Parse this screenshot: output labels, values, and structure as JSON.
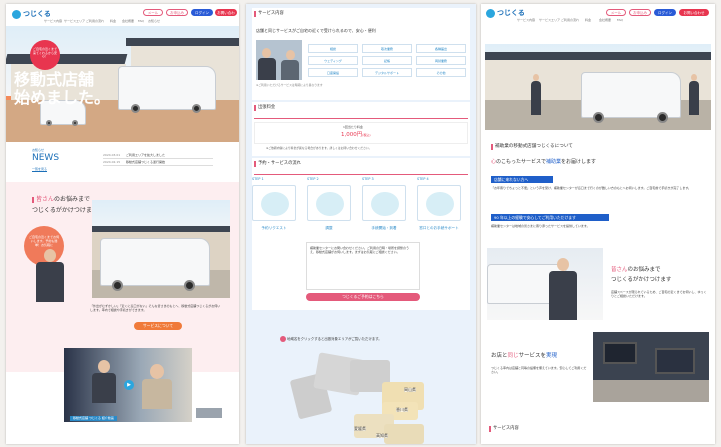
{
  "brand": {
    "logo_text": "つじくる",
    "logo_small": "移動式店舗"
  },
  "nav": {
    "items": [
      "サービス内容",
      "サービスエリア",
      "ご利用の流れ",
      "料金",
      "会社概要",
      "採用情報",
      "FAQ",
      "お知らせ",
      "プライバシーポリシー"
    ],
    "btn_mail": "メール",
    "btn_apply": "お申込み",
    "btn_login": "ログイン",
    "btn_contact": "お問い合わせ"
  },
  "left": {
    "hero_bubble": "ご自宅の近くまで来てくれるから安心！",
    "hero_title_1": "移動式店舗",
    "hero_title_2": "始めました。",
    "news_label": "NEWS",
    "news_small": "お知らせ",
    "news_more": "一覧を見る",
    "news": [
      {
        "date": "2024.03.01",
        "text": "ご利用エリアを拡大しました"
      },
      {
        "date": "2024.02.15",
        "text": "移動式店舗つじくる運行開始"
      }
    ],
    "catch_1a": "皆さん",
    "catch_1b": "のお悩みまで",
    "catch_2": "つじくるがかけつけます",
    "bubble": "ご自宅の近くまでお伺いします。予約も簡単！お気軽に",
    "body": "「外出がむずかしい」「近くに窓口がない」そんな皆さまのもとへ、移動式店舗つじくるがお伺いします。車内で相談や手続きができます。",
    "btn": "サービスについて",
    "video_caption": "移動式店舗 つじくる 紹介動画"
  },
  "middle": {
    "sec1": "サービス内容",
    "sec1_text": "店舗と同じサービスがご自宅の近くで受けられるので、安心・便利",
    "tags": [
      "相談",
      "取次業務",
      "各種届出",
      "ウェディング",
      "記帳",
      "両替業務",
      "口座開設",
      "デジタルサポート",
      "その他"
    ],
    "sec1_note": "※ご利用いただけるサービスは時期により異なります",
    "sec2": "出張料金",
    "price_label": "1回当たり料金",
    "price": "1,000円",
    "price_tax": "(税込)",
    "price_note": "※ご依頼内容により料金が異なる場合があります。詳しくはお問い合わせください。",
    "sec3": "予約・サービスの流れ",
    "steps": [
      {
        "label": "STEP 1",
        "cap": "予約リクエスト"
      },
      {
        "label": "STEP 2",
        "cap": "調整"
      },
      {
        "label": "STEP 3",
        "cap": "手続開始・到着"
      },
      {
        "label": "STEP 4",
        "cap": "窓口とのお手続サポート"
      }
    ],
    "center_note": "補助業センターにお問い合わせください。ご利用の日時・場所を調整のうえ、移動式店舗がお伺いします。まずはお気軽にご相談ください。",
    "cta": "つじくるご予約はこちら",
    "map_hint": "地域名をクリックすると出張対象エリアがご覧いただけます。",
    "map_labels": [
      "岡山県",
      "香川県",
      "愛媛県",
      "高知県"
    ]
  },
  "right": {
    "sec_title": "補助業の移動式店舗つじくるについて",
    "lead_1": "心",
    "lead_2": "のこもったサービスで",
    "lead_3": "補助業",
    "lead_4": "をお届けします",
    "bar1": "店舗に来れない方へ",
    "text1": "「お年寄りでちょっと不便」という声を受け、補助業センターが窓口まで行くのが難しい方のもとへお伺いします。ご自宅前で手続きが完了します。",
    "bar2": "90 年以上の経験で安心してご利用いただけます",
    "text2": "補助業センターは地域の皆さまに寄り添ったサービスを提供しています。",
    "catch_1a": "皆さん",
    "catch_1b": "のお悩みまで",
    "catch_2": "つじくるがかけつけます",
    "catch_text": "店舗スペースが限られているため、ご自宅の近くまでお伺いし、ゆっくりとご相談いただけます。",
    "sub_1a": "お店と",
    "sub_1b": "同じ",
    "sub_1c": "サービスを",
    "sub_1d": "実現",
    "sub_text": "つじくる車内は店舗と同等の設備を備えています。安心してご利用ください。",
    "sec_bottom": "サービス内容"
  },
  "colors": {
    "pink": "#e45a7b",
    "blue": "#1f5fc9",
    "red": "#e8354f",
    "hero_orange": "#f38a5a"
  }
}
